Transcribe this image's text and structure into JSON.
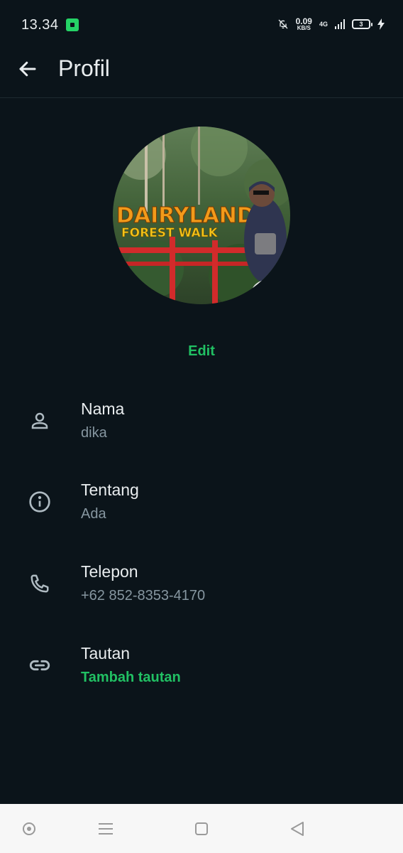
{
  "status_bar": {
    "time": "13.34",
    "net_speed_value": "0.09",
    "net_speed_unit": "KB/S",
    "network_type": "4G",
    "battery_level": "3"
  },
  "header": {
    "title": "Profil"
  },
  "profile": {
    "edit_label": "Edit",
    "photo_sign_line1": "DAIRYLAND",
    "photo_sign_line2": "FOREST WALK"
  },
  "fields": {
    "name": {
      "label": "Nama",
      "value": "dika",
      "icon": "person-icon"
    },
    "about": {
      "label": "Tentang",
      "value": "Ada",
      "icon": "info-icon"
    },
    "phone": {
      "label": "Telepon",
      "value": "+62 852-8353-4170",
      "icon": "phone-icon"
    },
    "links": {
      "label": "Tautan",
      "value": "Tambah tautan",
      "icon": "link-icon"
    }
  },
  "colors": {
    "background": "#0b141a",
    "accent": "#21c063",
    "secondary_text": "#8696a0",
    "icon": "#aebac1"
  }
}
